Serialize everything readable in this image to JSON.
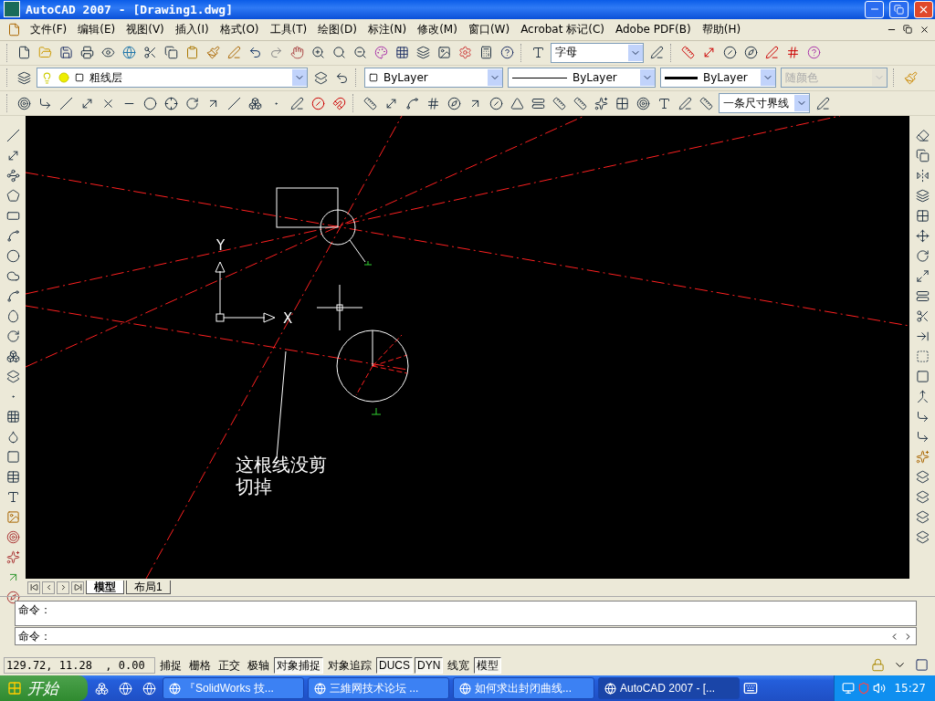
{
  "window": {
    "title": "AutoCAD 2007 - [Drawing1.dwg]"
  },
  "menu": [
    "文件(F)",
    "编辑(E)",
    "视图(V)",
    "插入(I)",
    "格式(O)",
    "工具(T)",
    "绘图(D)",
    "标注(N)",
    "修改(M)",
    "窗口(W)",
    "Acrobat 标记(C)",
    "Adobe PDF(B)",
    "帮助(H)"
  ],
  "toolbars": {
    "text_style": "字母",
    "layer": "粗线层",
    "color_control": "ByLayer",
    "linetype": "ByLayer",
    "lineweight": "ByLayer",
    "plot_style": {
      "value": "随颜色",
      "disabled": true
    },
    "dim_style": "一条尺寸界线"
  },
  "canvas": {
    "ucs": {
      "x_label": "X",
      "y_label": "Y"
    },
    "annotation": "这根线没剪切掉"
  },
  "layout_tabs": [
    {
      "label": "模型",
      "selected": true
    },
    {
      "label": "布局1",
      "selected": false
    }
  ],
  "command_lines": [
    "命令：",
    "命令："
  ],
  "status_bar": {
    "coordinates": "129.72, 11.28  , 0.00",
    "toggles": [
      {
        "label": "捕捉",
        "on": false
      },
      {
        "label": "栅格",
        "on": false
      },
      {
        "label": "正交",
        "on": false
      },
      {
        "label": "极轴",
        "on": false
      },
      {
        "label": "对象捕捉",
        "on": true
      },
      {
        "label": "对象追踪",
        "on": false
      },
      {
        "label": "DUCS",
        "on": true
      },
      {
        "label": "DYN",
        "on": true
      },
      {
        "label": "线宽",
        "on": false
      },
      {
        "label": "模型",
        "on": true
      }
    ]
  },
  "taskbar": {
    "start": "开始",
    "tasks": [
      {
        "label": "『SolidWorks 技...",
        "selected": false
      },
      {
        "label": "三維网技术论坛 ...",
        "selected": false
      },
      {
        "label": "如何求出封闭曲线...",
        "selected": false
      },
      {
        "label": "AutoCAD 2007 - [...",
        "selected": true
      }
    ],
    "clock": "15:27"
  }
}
